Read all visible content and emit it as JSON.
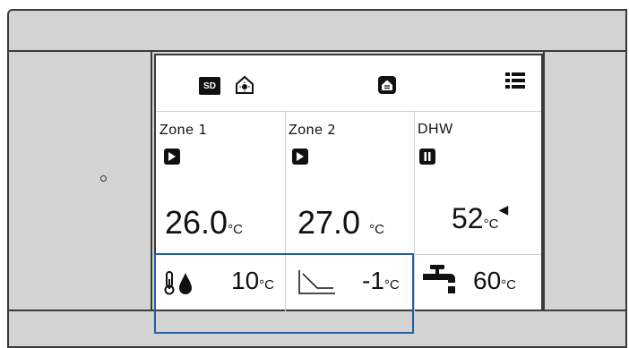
{
  "status_bar": {
    "sd_label": "SD",
    "icons": [
      "sd-card-icon",
      "house-sun-icon",
      "house-mode-icon",
      "menu-icon"
    ]
  },
  "zones": [
    {
      "label": "Zone",
      "number": "1",
      "state": "play",
      "temperature": "26.0",
      "unit": "°C"
    },
    {
      "label": "Zone",
      "number": "2",
      "state": "play",
      "temperature": "27.0",
      "unit": "°C"
    },
    {
      "label": "DHW",
      "number": "",
      "state": "pause",
      "temperature": "52",
      "unit": "°C",
      "indicator": "◀"
    }
  ],
  "bottom_row": {
    "zone1_value": "10",
    "zone1_unit": "°C",
    "zone2_value": "-1",
    "zone2_unit": "°C",
    "dhw_value": "60",
    "dhw_unit": "°C"
  },
  "colors": {
    "highlight": "#1f5fa8",
    "panel": "#d3d3d3",
    "screen": "#ffffff"
  }
}
